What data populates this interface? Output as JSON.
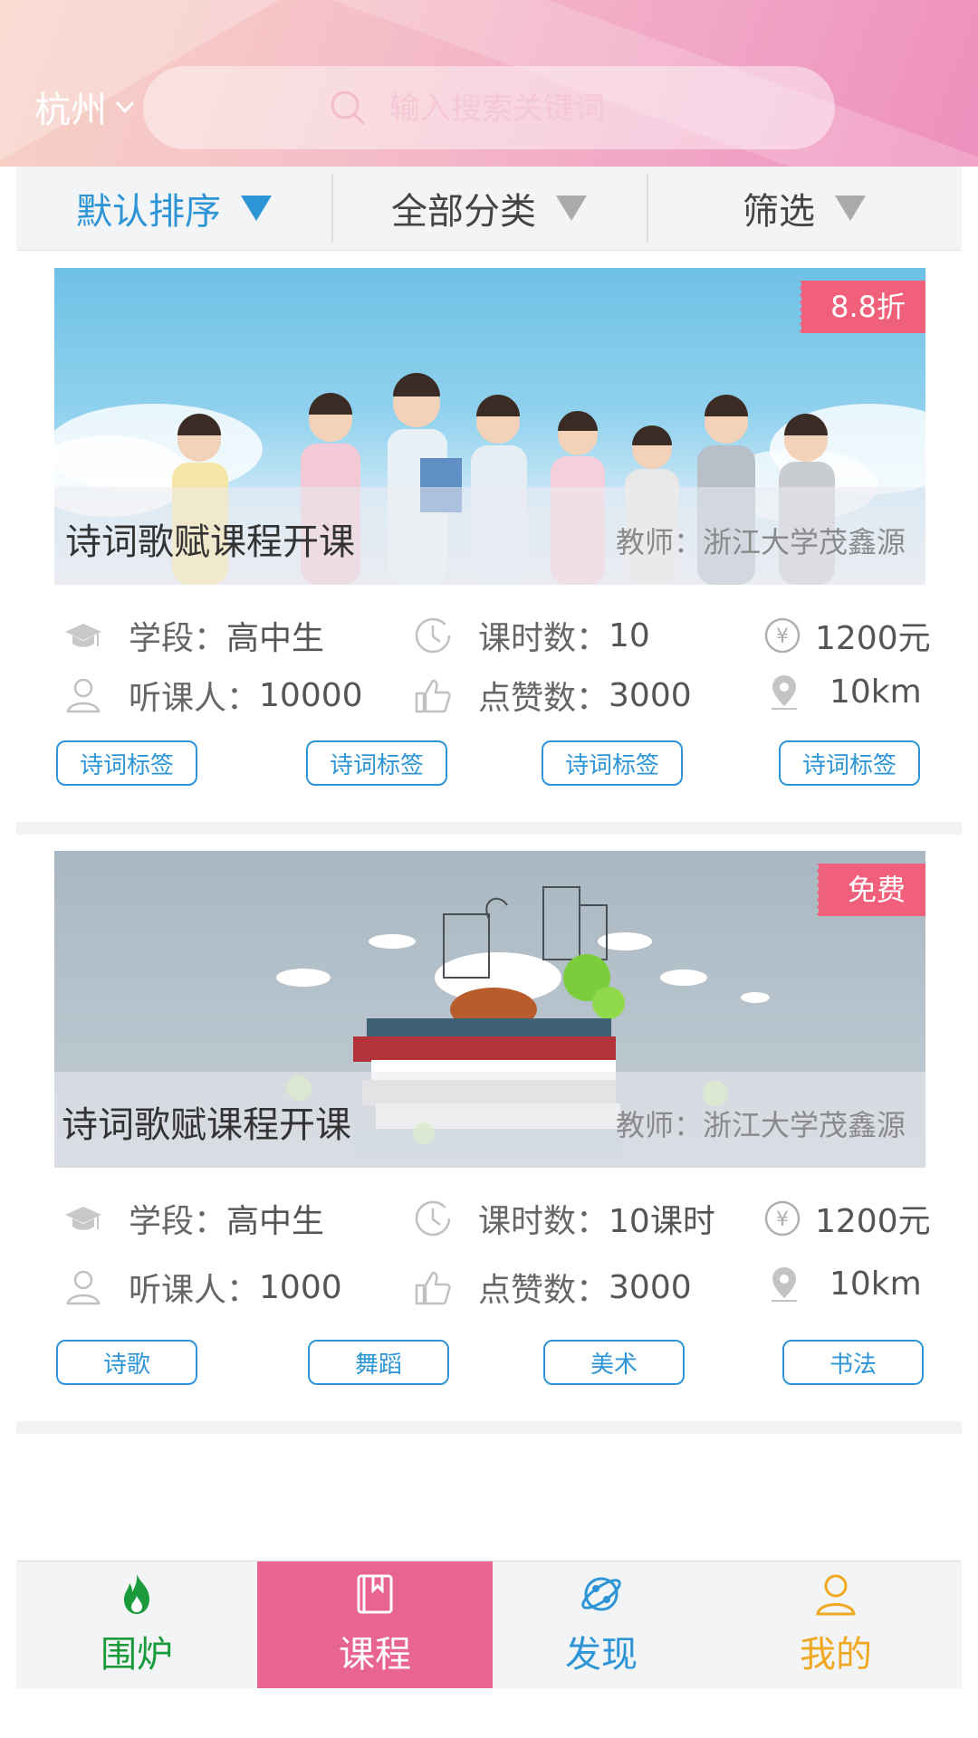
{
  "header": {
    "city": "杭州",
    "search_placeholder": "输入搜索关键词"
  },
  "filters": [
    {
      "label": "默认排序",
      "active": true
    },
    {
      "label": "全部分类",
      "active": false
    },
    {
      "label": "筛选",
      "active": false
    }
  ],
  "courses": [
    {
      "badge": "8.8折",
      "title": "诗词歌赋课程开课",
      "teacher": "教师：浙江大学茂鑫源",
      "stage_label": "学段：",
      "stage": "高中生",
      "hours_label": "课时数：",
      "hours": "10",
      "price": "1200元",
      "listeners_label": "听课人：",
      "listeners": "10000",
      "likes_label": "点赞数：",
      "likes": "3000",
      "distance": "10km",
      "tags": [
        "诗词标签",
        "诗词标签",
        "诗词标签",
        "诗词标签"
      ]
    },
    {
      "badge": "免费",
      "title": "诗词歌赋课程开课",
      "teacher": "教师：浙江大学茂鑫源",
      "stage_label": "学段：",
      "stage": "高中生",
      "hours_label": "课时数：",
      "hours": "10课时",
      "price": "1200元",
      "listeners_label": "听课人：",
      "listeners": "1000",
      "likes_label": "点赞数：",
      "likes": "3000",
      "distance": "10km",
      "tags": [
        "诗歌",
        "舞蹈",
        "美术",
        "书法"
      ]
    }
  ],
  "tabbar": [
    {
      "label": "围炉",
      "icon": "flame-icon",
      "color": "#1a9a3a"
    },
    {
      "label": "课程",
      "icon": "book-icon",
      "color": "#ffffff",
      "active": true
    },
    {
      "label": "发现",
      "icon": "planet-icon",
      "color": "#2d95d6"
    },
    {
      "label": "我的",
      "icon": "user-icon",
      "color": "#f0a820"
    }
  ],
  "colors": {
    "accent_blue": "#2d95d6",
    "badge_red": "#f0607a",
    "active_tab_pink": "#e96591"
  }
}
